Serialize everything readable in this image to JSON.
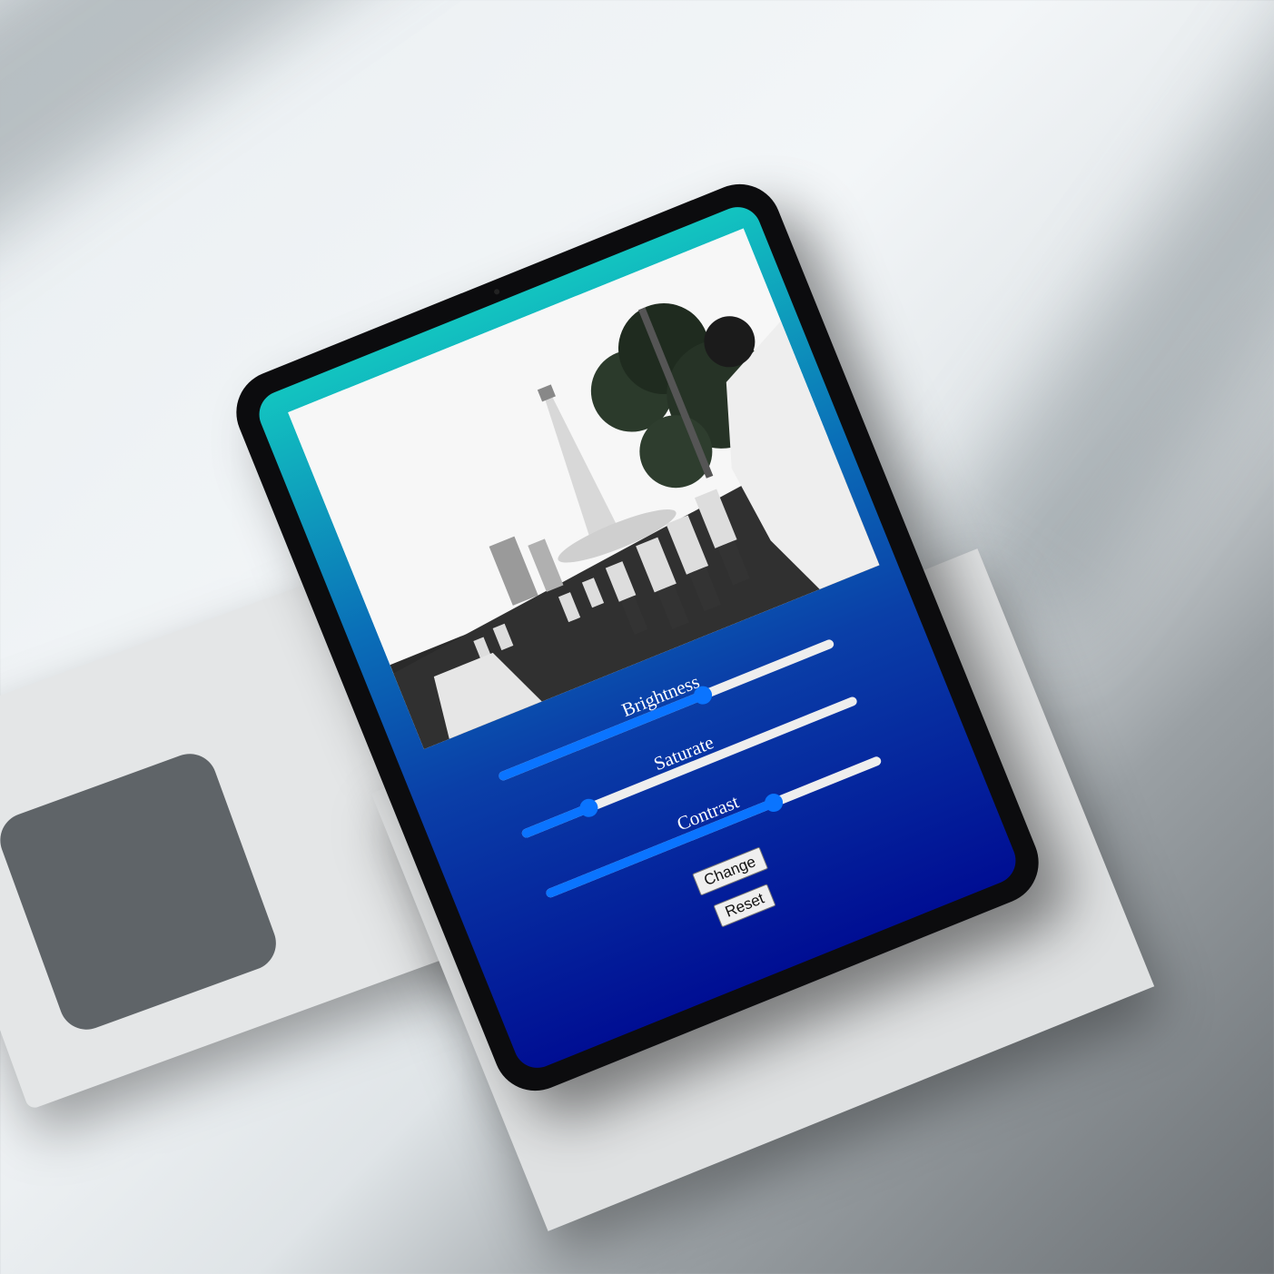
{
  "app": {
    "controls": [
      {
        "label": "Brightness",
        "value_percent": 61
      },
      {
        "label": "Saturate",
        "value_percent": 20
      },
      {
        "label": "Contrast",
        "value_percent": 68
      }
    ],
    "buttons": {
      "change": "Change",
      "reset": "Reset"
    },
    "colors": {
      "gradient_top": "#12c4c0",
      "gradient_bottom": "#000e93",
      "slider_accent": "#0a74ff"
    }
  }
}
